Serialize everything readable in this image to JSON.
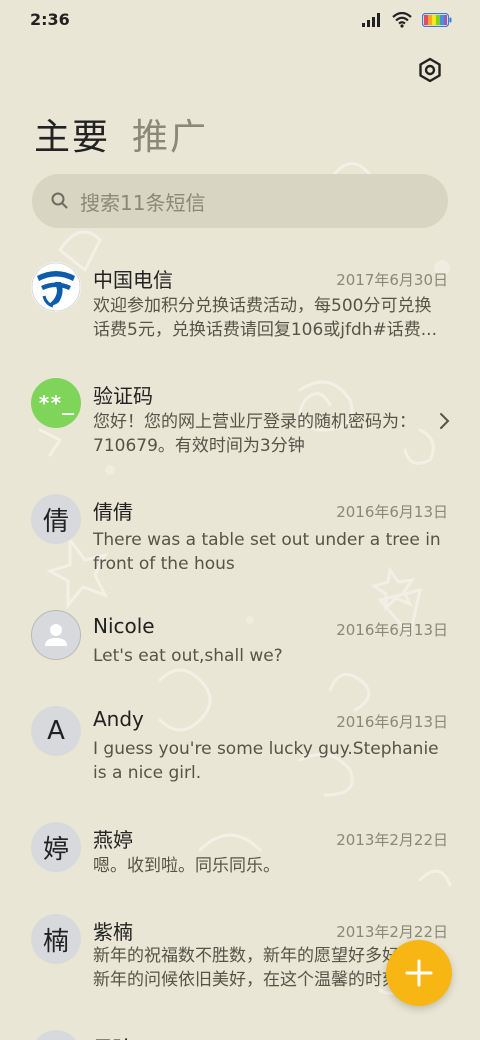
{
  "status_bar": {
    "time": "2:36"
  },
  "tabs": [
    {
      "label": "主要",
      "active": true
    },
    {
      "label": "推广",
      "active": false
    }
  ],
  "search": {
    "placeholder": "搜索11条短信"
  },
  "conversations": [
    {
      "name": "中国电信",
      "date": "2017年6月30日",
      "avatar": "china-telecom-logo",
      "preview_lines": [
        "欢迎参加积分兑换话费活动，每500分可兑换",
        "话费5元，兑换话费请回复106或jfdh#话费..."
      ]
    },
    {
      "name": "验证码",
      "date": "",
      "avatar_text": "**_",
      "preview_lines": [
        "您好！您的网上营业厅登录的随机密码为：",
        "710679。有效时间为3分钟"
      ],
      "has_chevron": true
    },
    {
      "name": "倩倩",
      "date": "2016年6月13日",
      "avatar_text": "倩",
      "preview_lines": [
        "There was a table set out under a tree in",
        "front of the hous"
      ]
    },
    {
      "name": "Nicole",
      "date": "2016年6月13日",
      "avatar": "person-icon",
      "preview_lines": [
        "Let's eat out,shall we?"
      ]
    },
    {
      "name": "Andy",
      "date": "2016年6月13日",
      "avatar_text": "A",
      "preview_lines": [
        "I guess you're some lucky guy.Stephanie",
        "is a nice girl."
      ]
    },
    {
      "name": "燕婷",
      "date": "2013年2月22日",
      "avatar_text": "婷",
      "preview_lines": [
        "嗯。收到啦。同乐同乐。"
      ]
    },
    {
      "name": "紫楠",
      "date": "2013年2月22日",
      "avatar_text": "楠",
      "preview_lines": [
        "新年的祝福数不胜数，新年的愿望好多好多，",
        "新年的问候依旧美好，在这个温馨的时刻"
      ]
    },
    {
      "name": "子玲",
      "date": "",
      "avatar_text": "",
      "preview_lines": []
    }
  ],
  "colors": {
    "background": "#e9e6d5",
    "accent": "#f7b614",
    "code_avatar": "#7fd45a",
    "telecom_blue": "#0d5bab"
  }
}
